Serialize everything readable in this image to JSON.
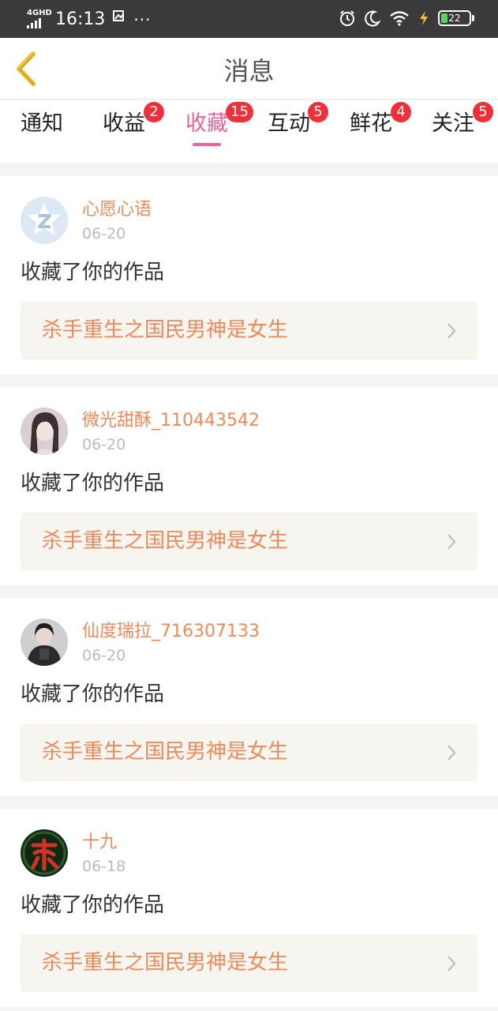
{
  "status_bar": {
    "network": "4GHD",
    "time": "16:13",
    "extra_icon": "screenshot-icon",
    "dots": "···",
    "battery_level": "22",
    "battery_fraction": 0.22,
    "icons": [
      "alarm-icon",
      "moon-icon",
      "wifi-icon",
      "charging-icon",
      "battery-icon"
    ]
  },
  "header": {
    "title": "消息",
    "back_icon": "chevron-left-icon",
    "back_color": "#f0c330"
  },
  "tabs": [
    {
      "label": "通知",
      "badge": ""
    },
    {
      "label": "收益",
      "badge": "2"
    },
    {
      "label": "收藏",
      "badge": "15",
      "active": true
    },
    {
      "label": "互动",
      "badge": "5"
    },
    {
      "label": "鲜花",
      "badge": "4"
    },
    {
      "label": "关注",
      "badge": "5"
    }
  ],
  "colors": {
    "accent": "#e8649a",
    "username": "#ee8a5a",
    "badge": "#ef2f3a",
    "work_title": "#ef8a5c"
  },
  "messages": [
    {
      "username": "心愿心语",
      "date": "06-20",
      "action": "收藏了你的作品",
      "work_title": "杀手重生之国民男神是女生",
      "avatar": "default-avatar-icon"
    },
    {
      "username": "微光甜酥_110443542",
      "date": "06-20",
      "action": "收藏了你的作品",
      "work_title": "杀手重生之国民男神是女生",
      "avatar": "user-photo-avatar"
    },
    {
      "username": "仙度瑞拉_716307133",
      "date": "06-20",
      "action": "收藏了你的作品",
      "work_title": "杀手重生之国民男神是女生",
      "avatar": "user-photo-avatar"
    },
    {
      "username": "十九",
      "date": "06-18",
      "action": "收藏了你的作品",
      "work_title": "杀手重生之国民男神是女生",
      "avatar": "user-logo-avatar"
    }
  ]
}
